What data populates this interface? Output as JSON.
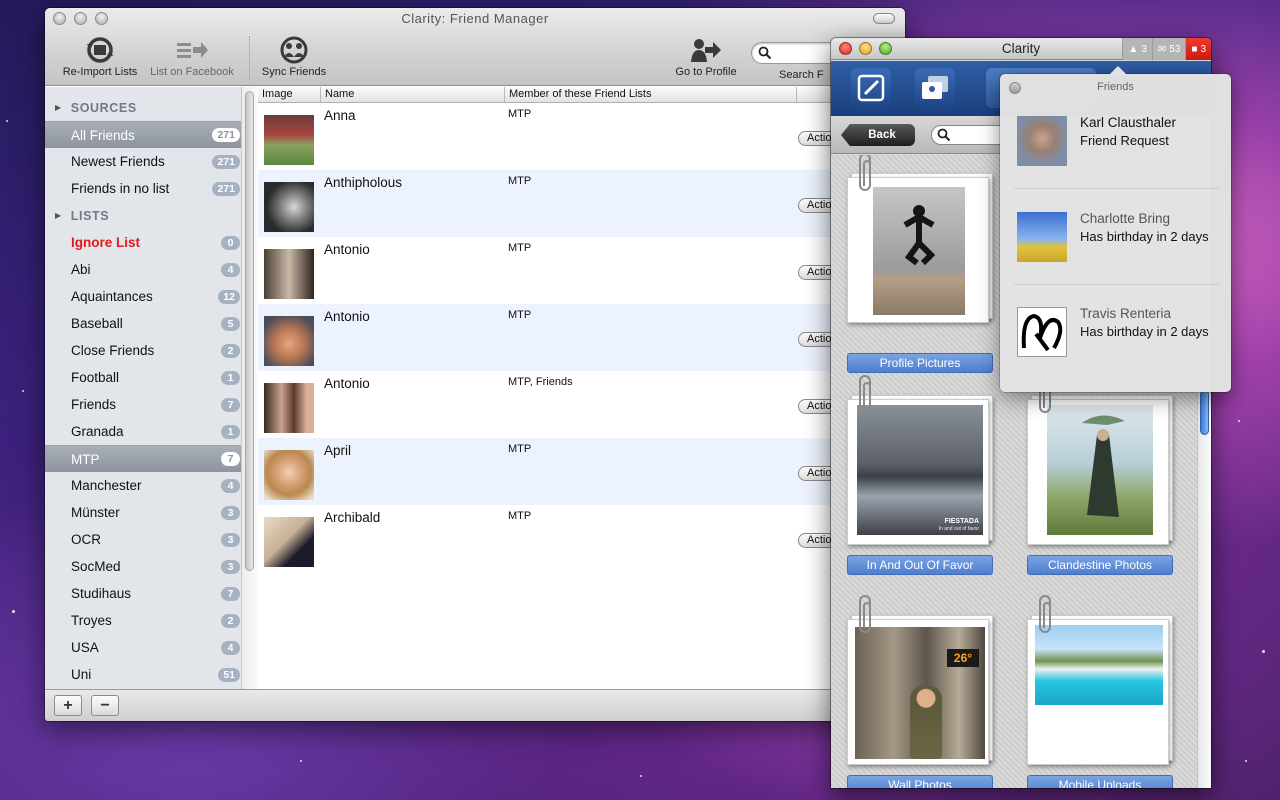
{
  "main_window": {
    "title": "Clarity: Friend Manager",
    "toolbar": {
      "reimport": "Re-Import Lists",
      "list_fb": "List on Facebook",
      "sync": "Sync Friends",
      "profile": "Go to Profile",
      "search": "Search F"
    },
    "sidebar": {
      "sources_header": "SOURCES",
      "lists_header": "LISTS",
      "sources": [
        {
          "label": "All Friends",
          "count": "271"
        },
        {
          "label": "Newest Friends",
          "count": "271"
        },
        {
          "label": "Friends in no list",
          "count": "271"
        }
      ],
      "lists": [
        {
          "label": "Ignore List",
          "count": "0"
        },
        {
          "label": "Abi",
          "count": "4"
        },
        {
          "label": "Aquaintances",
          "count": "12"
        },
        {
          "label": "Baseball",
          "count": "5"
        },
        {
          "label": "Close Friends",
          "count": "2"
        },
        {
          "label": "Football",
          "count": "1"
        },
        {
          "label": "Friends",
          "count": "7"
        },
        {
          "label": "Granada",
          "count": "1"
        },
        {
          "label": "MTP",
          "count": "7"
        },
        {
          "label": "Manchester",
          "count": "4"
        },
        {
          "label": "Münster",
          "count": "3"
        },
        {
          "label": "OCR",
          "count": "3"
        },
        {
          "label": "SocMed",
          "count": "3"
        },
        {
          "label": "Studihaus",
          "count": "7"
        },
        {
          "label": "Troyes",
          "count": "2"
        },
        {
          "label": "USA",
          "count": "4"
        },
        {
          "label": "Uni",
          "count": "51"
        }
      ]
    },
    "table": {
      "columns": [
        "Image",
        "Name",
        "Member of these Friend Lists"
      ],
      "action_label": "Actio",
      "rows": [
        {
          "name": "Anna",
          "lists": "MTP"
        },
        {
          "name": "Anthipholous",
          "lists": "MTP"
        },
        {
          "name": "Antonio",
          "lists": "MTP"
        },
        {
          "name": "Antonio",
          "lists": "MTP"
        },
        {
          "name": "Antonio",
          "lists": "MTP, Friends"
        },
        {
          "name": "April",
          "lists": "MTP"
        },
        {
          "name": "Archibald",
          "lists": "MTP"
        }
      ]
    },
    "add_btn": "+",
    "remove_btn": "−"
  },
  "clarity_window": {
    "title": "Clarity",
    "counters": {
      "friends": "3",
      "messages": "53",
      "notifications": "3"
    },
    "back_label": "Back",
    "albums": [
      {
        "label": "Profile Pictures"
      },
      {
        "label": "In And Out Of Favor"
      },
      {
        "label": "Clandestine Photos"
      },
      {
        "label": "Wall Photos"
      },
      {
        "label": "Mobile Uploads"
      }
    ],
    "photo_caption": "FIESTADA",
    "photo_subcaption": "In and out of favor",
    "sign_text": "26°"
  },
  "popover": {
    "title": "Friends",
    "notifications": [
      {
        "name": "Karl Clausthaler",
        "text": "Friend Request"
      },
      {
        "name": "Charlotte Bring",
        "text": "Has birthday in 2 days"
      },
      {
        "name": "Travis Renteria",
        "text": "Has birthday in 2 days"
      }
    ]
  },
  "colors": {
    "accent_blue": "#4e7fcf",
    "danger_red": "#e41b1b",
    "nav_blue": "#1b3f7e"
  }
}
